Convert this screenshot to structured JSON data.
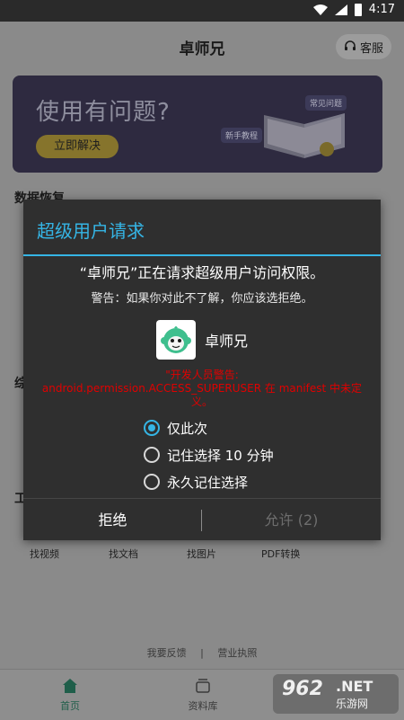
{
  "status_bar": {
    "time": "4:17"
  },
  "app": {
    "title": "卓师兄",
    "service_label": "客服",
    "banner": {
      "headline": "使用有问题?",
      "cta": "立即解决",
      "tag_faq": "常见问题",
      "tag_tutorial": "新手教程"
    },
    "section_recovery": "数据恢复",
    "section_partial_a": "综",
    "section_partial_b": "工",
    "tools": [
      "找视频",
      "找文档",
      "找图片",
      "PDF转换"
    ],
    "footer": {
      "feedback": "我要反馈",
      "separator": "|",
      "license": "营业执照"
    },
    "tabs": [
      {
        "label": "首页"
      },
      {
        "label": "资料库"
      }
    ]
  },
  "watermark": {
    "number": "962",
    "net": ".NET",
    "cn": "乐游网"
  },
  "dialog": {
    "title": "超级用户请求",
    "message": "“卓师兄”正在请求超级用户访问权限。",
    "warning": "警告：如果你对此不了解，你应该选拒绝。",
    "app_name": "卓师兄",
    "dev_warning_line1": "\"开发人员警告:",
    "dev_warning_line2": "android.permission.ACCESS_SUPERUSER 在 manifest 中未定",
    "dev_warning_line3": "义。",
    "options": [
      {
        "label": "仅此次",
        "checked": true
      },
      {
        "label": "记住选择 10 分钟",
        "checked": false
      },
      {
        "label": "永久记住选择",
        "checked": false
      }
    ],
    "deny_label": "拒绝",
    "allow_label": "允许 (2)"
  },
  "colors": {
    "accent": "#35b5e5",
    "warning": "#e00000",
    "dialog_bg": "#2f2f2f",
    "app_icon_green": "#3fbf8e"
  }
}
